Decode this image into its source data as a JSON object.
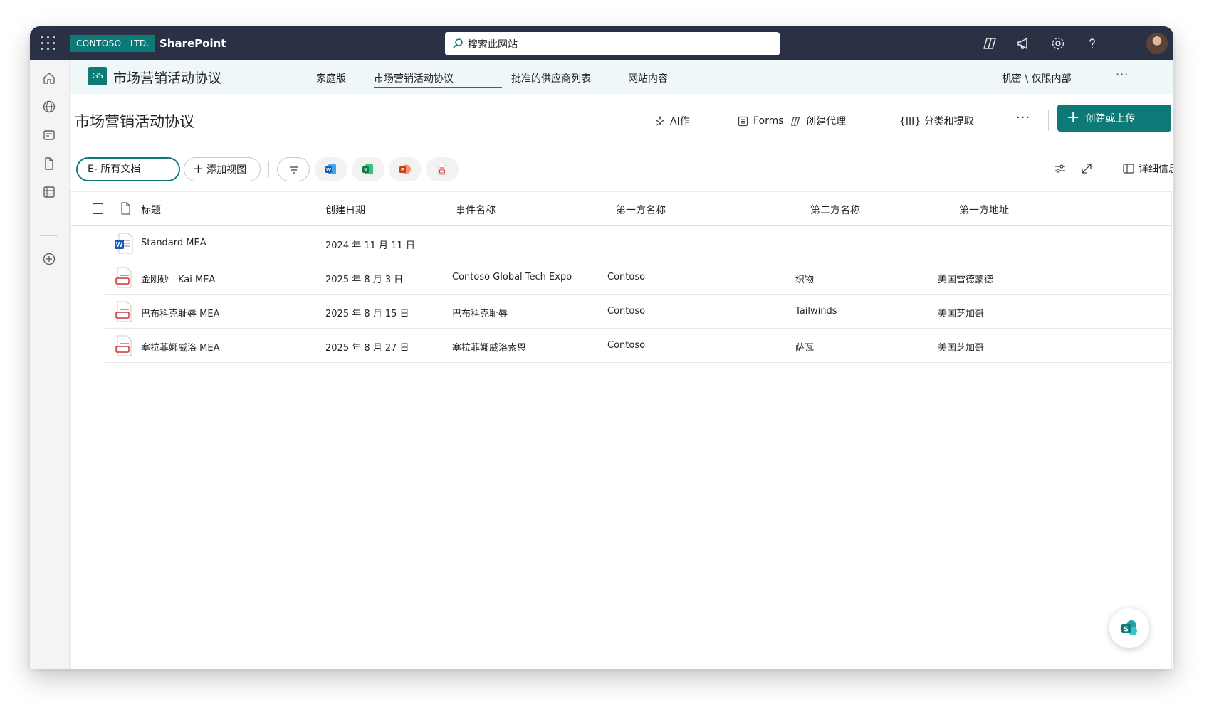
{
  "suite": {
    "tenant": "CONTOSO　LTD.",
    "app_name": "SharePoint",
    "search_placeholder": "搜索此网站"
  },
  "site": {
    "logo": "GS",
    "title": "市场营销活动协议",
    "nav": [
      "家庭版",
      "市场营销活动协议",
      "批准的供应商列表",
      "网站内容"
    ],
    "classification": "机密 \\ 仅限内部",
    "more": "···"
  },
  "library": {
    "title": "市场营销活动协议",
    "commands": {
      "ai": "AI作",
      "forms": "Forms",
      "agent": "创建代理",
      "classify": "{III} 分类和提取",
      "more": "···",
      "create": "创建或上传"
    }
  },
  "viewbar": {
    "current_view": "E- 所有文档",
    "add_view": "添加视图",
    "details": "详细信息"
  },
  "table": {
    "columns": [
      "标题",
      "创建日期",
      "事件名称",
      "第一方名称",
      "第二方名称",
      "第一方地址"
    ],
    "rows": [
      {
        "icon": "word",
        "title": "Standard MEA",
        "date": "2024 年 11 月 11 日",
        "event": "",
        "party1": "",
        "party2": "",
        "address": ""
      },
      {
        "icon": "pdf",
        "title": "金刚砂　Kai MEA",
        "date": "2025 年 8 月 3 日",
        "event": "Contoso Global Tech Expo",
        "party1": "Contoso",
        "party2": "织物",
        "address": "美国雷德蒙德"
      },
      {
        "icon": "pdf",
        "title": "巴布科克耻辱 MEA",
        "date": "2025 年 8 月 15 日",
        "event": "巴布科克耻辱",
        "party1": "Contoso",
        "party2": "Tailwinds",
        "address": "美国芝加哥"
      },
      {
        "icon": "pdf",
        "title": "塞拉菲娜威洛 MEA",
        "date": "2025 年 8 月 27 日",
        "event": "塞拉菲娜威洛索恩",
        "party1": "Contoso",
        "party2": "萨瓦",
        "address": "美国芝加哥"
      }
    ]
  },
  "colors": {
    "suite_bar": "#2b3145",
    "accent": "#0e7a78",
    "site_header": "#eff7f8"
  }
}
